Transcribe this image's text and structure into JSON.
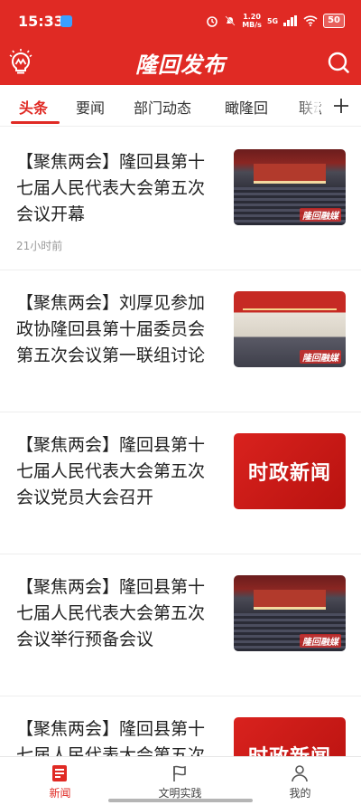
{
  "status_bar": {
    "time": "15:33",
    "net_speed_value": "1.20",
    "net_speed_unit": "MB/s",
    "network": "5G",
    "battery": "50"
  },
  "header": {
    "title": "隆回发布",
    "left_icon": "lightbulb-logo-icon",
    "right_icon": "search-icon",
    "brand_color": "#e02a24"
  },
  "tabs": {
    "items": [
      "头条",
      "要闻",
      "部门动态",
      "瞰隆回",
      "联动"
    ],
    "active_index": 0,
    "add_icon": "plus-icon"
  },
  "feed": [
    {
      "headline": "【聚焦两会】隆回县第十七届人民代表大会第五次会议开幕",
      "time": "21小时前",
      "thumb_mark": "隆回融媒"
    },
    {
      "headline": "【聚焦两会】刘厚见参加政协隆回县第十届委员会第五次会议第一联组讨论",
      "thumb_mark": "隆回融媒"
    },
    {
      "headline": "【聚焦两会】隆回县第十七届人民代表大会第五次会议党员大会召开",
      "thumb_text": "时政新闻"
    },
    {
      "headline": "【聚焦两会】隆回县第十七届人民代表大会第五次会议举行预备会议",
      "thumb_mark": "隆回融媒"
    },
    {
      "headline": "【聚焦两会】隆回县第十七届人民代表大会第五次",
      "thumb_text": "时政新闻"
    }
  ],
  "bottom_nav": [
    {
      "label": "新闻",
      "icon": "news-icon",
      "active": true
    },
    {
      "label": "文明实践",
      "icon": "flag-icon",
      "active": false
    },
    {
      "label": "我的",
      "icon": "person-icon",
      "active": false
    }
  ]
}
